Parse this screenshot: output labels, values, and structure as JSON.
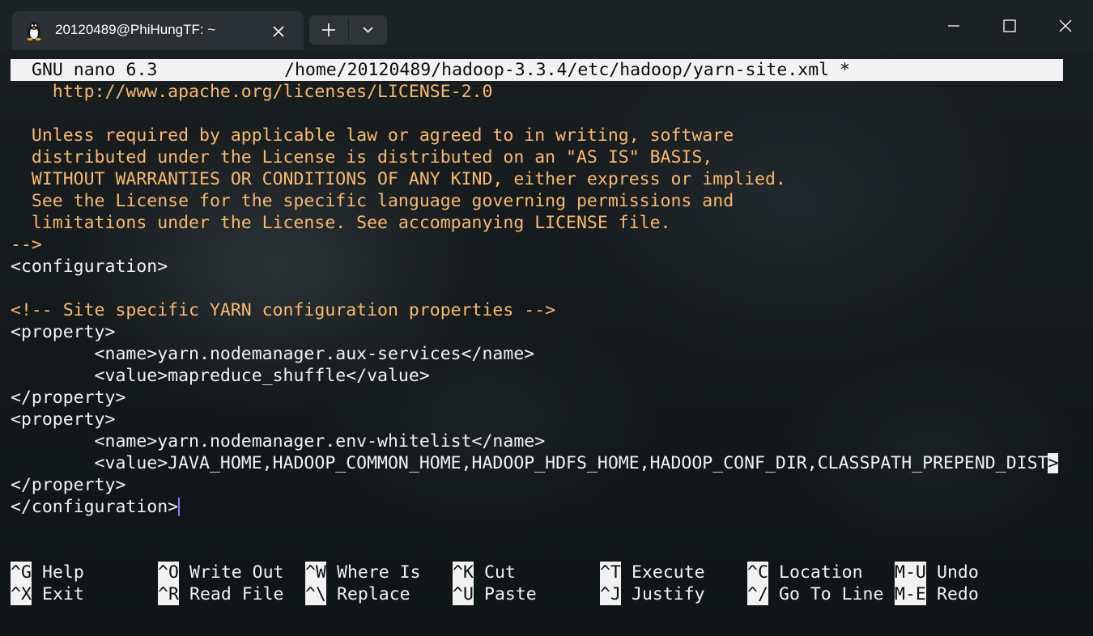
{
  "window": {
    "tab_title": "20120489@PhiHungTF: ~",
    "tab_icon": "linux-penguin-icon",
    "controls": [
      "minimize-icon",
      "maximize-icon",
      "close-icon"
    ]
  },
  "nano": {
    "version_label": "GNU nano 6.3",
    "file_path": "/home/20120489/hadoop-3.3.4/etc/hadoop/yarn-site.xml *",
    "lines": [
      "    http://www.apache.org/licenses/LICENSE-2.0",
      "",
      "  Unless required by applicable law or agreed to in writing, software",
      "  distributed under the License is distributed on an \"AS IS\" BASIS,",
      "  WITHOUT WARRANTIES OR CONDITIONS OF ANY KIND, either express or implied.",
      "  See the License for the specific language governing permissions and",
      "  limitations under the License. See accompanying LICENSE file.",
      "-->",
      "<configuration>",
      "",
      "<!-- Site specific YARN configuration properties -->",
      "<property>",
      "        <name>yarn.nodemanager.aux-services</name>",
      "        <value>mapreduce_shuffle</value>",
      "</property>",
      "<property>",
      "        <name>yarn.nodemanager.env-whitelist</name>",
      "        <value>JAVA_HOME,HADOOP_COMMON_HOME,HADOOP_HDFS_HOME,HADOOP_CONF_DIR,CLASSPATH_PREPEND_DIST",
      "</property>",
      "</configuration>"
    ],
    "overflow_marker": ">",
    "shortcuts": [
      {
        "key": "^G",
        "label": "Help"
      },
      {
        "key": "^X",
        "label": "Exit"
      },
      {
        "key": "^O",
        "label": "Write Out"
      },
      {
        "key": "^R",
        "label": "Read File"
      },
      {
        "key": "^W",
        "label": "Where Is"
      },
      {
        "key": "^\\",
        "label": "Replace"
      },
      {
        "key": "^K",
        "label": "Cut"
      },
      {
        "key": "^U",
        "label": "Paste"
      },
      {
        "key": "^T",
        "label": "Execute"
      },
      {
        "key": "^J",
        "label": "Justify"
      },
      {
        "key": "^C",
        "label": "Location"
      },
      {
        "key": "^/",
        "label": "Go To Line"
      },
      {
        "key": "M-U",
        "label": "Undo"
      },
      {
        "key": "M-E",
        "label": "Redo"
      }
    ]
  },
  "colors": {
    "comment": "#f9b96e",
    "text": "#f2f2f2",
    "header_bg": "#f2f2f2",
    "cursor": "#8b7dff"
  }
}
